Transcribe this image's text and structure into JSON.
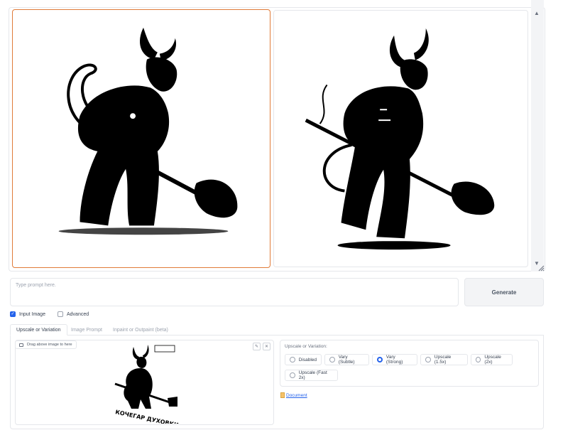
{
  "gallery": {
    "images": [
      "devil-with-shovel-generated-1",
      "devil-with-shovel-generated-2"
    ]
  },
  "prompt": {
    "placeholder": "Type prompt here."
  },
  "generate": {
    "label": "Generate"
  },
  "options": {
    "input_image": {
      "label": "Input Image",
      "checked": true
    },
    "advanced": {
      "label": "Advanced",
      "checked": false
    }
  },
  "tabs": [
    {
      "label": "Upscale or Variation",
      "active": true
    },
    {
      "label": "Image Prompt",
      "active": false
    },
    {
      "label": "Inpaint or Outpaint (beta)",
      "active": false
    }
  ],
  "dropzone": {
    "label": "Drag above image to here",
    "stamp_text": "КОЧЕГАР ДУХОВКИ"
  },
  "upscale": {
    "title": "Upscale or Variation:",
    "choices": [
      "Disabled",
      "Vary (Subtle)",
      "Vary (Strong)",
      "Upscale (1.5x)",
      "Upscale (2x)",
      "Upscale (Fast 2x)"
    ],
    "selected": "Vary (Strong)"
  },
  "document_link": {
    "label": "Document"
  },
  "colors": {
    "accent": "#2563eb",
    "selected_border": "#e07b39"
  }
}
